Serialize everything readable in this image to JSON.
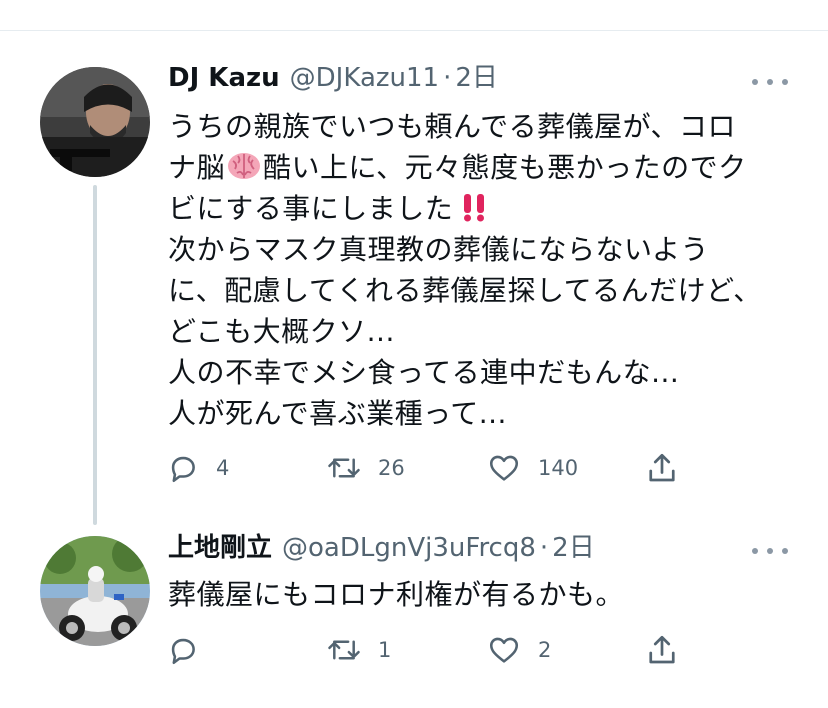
{
  "tweets": [
    {
      "name": "DJ Kazu",
      "handle": "@DJKazu11",
      "separator": "·",
      "time": "2日",
      "lines": [
        "うちの親族でいつも頼んでる葬儀屋が、コロ",
        "ナ脳",
        "酷い上に、元々態度も悪かったのでク",
        "ビにする事にしました",
        "次からマスク真理教の葬儀にならないよう",
        "に、配慮してくれる葬儀屋探してるんだけど、",
        "どこも大概クソ...",
        "人の不幸でメシ食ってる連中だもんな...",
        "人が死んで喜ぶ業種って..."
      ],
      "emoji": [
        "brain-emoji",
        "double-exclamation-emoji"
      ],
      "replies": "4",
      "retweets": "26",
      "likes": "140"
    },
    {
      "name": "上地剛立",
      "handle": "@oaDLgnVj3uFrcq8",
      "separator": "·",
      "time": "2日",
      "lines": [
        "葬儀屋にもコロナ利権が有るかも。"
      ],
      "replies": "",
      "retweets": "1",
      "likes": "2"
    }
  ],
  "icons": [
    "reply-icon",
    "retweet-icon",
    "like-icon",
    "share-icon",
    "more-icon"
  ],
  "colors": {
    "text": "#0f1419",
    "secondary": "#536471",
    "thread_line": "#cfd9de",
    "exclamation": "#e0245e"
  }
}
